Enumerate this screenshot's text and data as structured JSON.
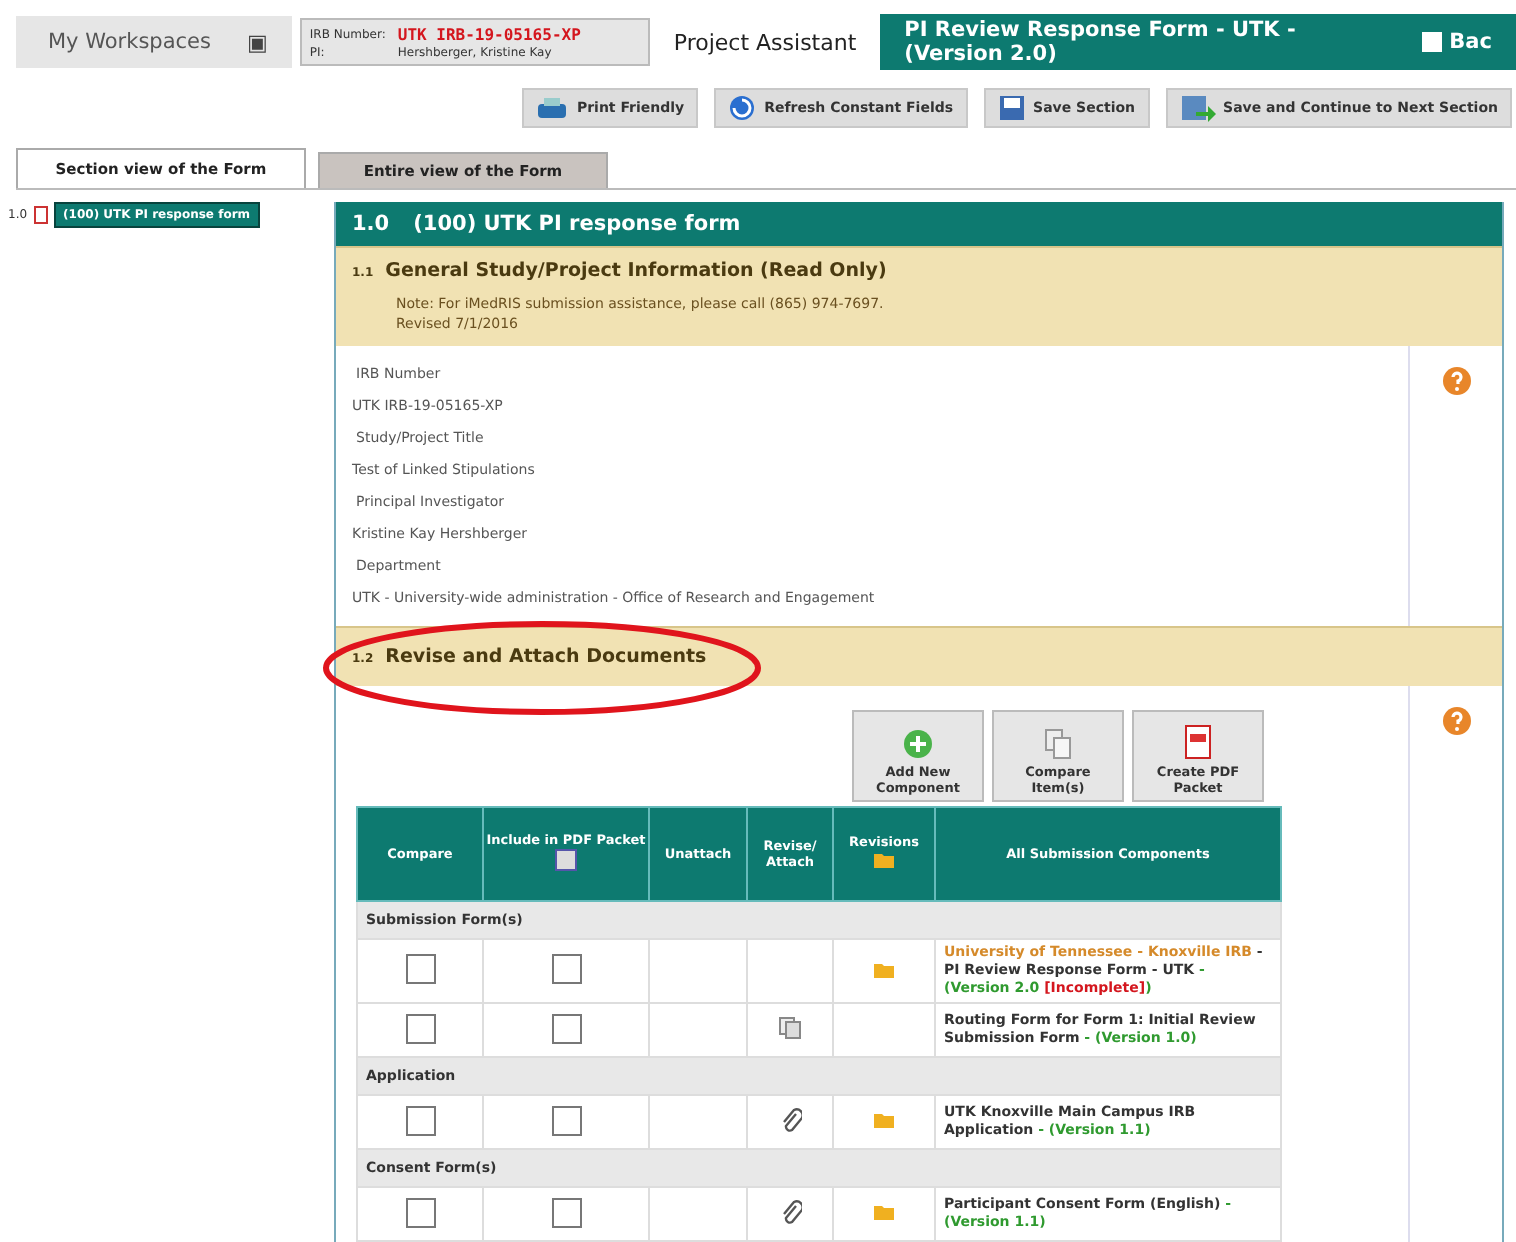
{
  "header": {
    "workspaces": "My Workspaces",
    "menu_glyph": "▣",
    "irb_label": "IRB Number:",
    "irb_value": "UTK IRB-19-05165-XP",
    "pi_label": "PI:",
    "pi_value": "Hershberger, Kristine Kay",
    "assistant": "Project Assistant",
    "form_title": "PI Review Response Form - UTK - (Version 2.0)",
    "back": "Bac"
  },
  "toolbar": [
    {
      "label": "Print Friendly"
    },
    {
      "label": "Refresh Constant Fields"
    },
    {
      "label": "Save Section"
    },
    {
      "label": "Save and Continue to Next Section"
    }
  ],
  "tabs": [
    {
      "label": "Section view of the Form",
      "selected": true
    },
    {
      "label": "Entire view of the Form",
      "selected": false
    }
  ],
  "tree": [
    {
      "number": "1.0",
      "label": "(100) UTK PI response form",
      "selected": true
    }
  ],
  "section": {
    "number": "1.0",
    "title": "(100) UTK PI response form"
  },
  "general": {
    "number": "1.1",
    "title": "General Study/Project Information (Read Only)",
    "note": "Note: For iMedRIS submission assistance, please call (865) 974-7697.",
    "revised": "Revised 7/1/2016"
  },
  "fields": [
    {
      "label": "IRB Number",
      "value": "UTK IRB-19-05165-XP"
    },
    {
      "label": "Study/Project Title",
      "value": "Test of Linked Stipulations"
    },
    {
      "label": "Principal Investigator",
      "value": "Kristine Kay Hershberger"
    },
    {
      "label": "Department",
      "value": "UTK - University-wide administration - Office of Research and Engagement"
    }
  ],
  "documents": {
    "number": "1.2",
    "title": "Revise and Attach Documents"
  },
  "actions": [
    {
      "label": "Add New Component"
    },
    {
      "label": "Compare Item(s)"
    },
    {
      "label": "Create PDF Packet"
    }
  ],
  "table": {
    "columns": [
      "Compare",
      "Include in PDF Packet",
      "Unattach",
      "Revise/ Attach",
      "Revisions",
      "All Submission Components"
    ],
    "groups": [
      {
        "name": "Submission Form(s)",
        "rows": [
          {
            "compare": false,
            "include": false,
            "kind": "form",
            "revisions": true,
            "parts": [
              {
                "kind": "source",
                "text": "University of Tennessee - Knoxville IRB"
              },
              {
                "kind": "title",
                "text": " - PI Review Response Form - UTK"
              },
              {
                "kind": "version",
                "text": " - (Version 2.0 "
              },
              {
                "kind": "status",
                "text": "[Incomplete]"
              },
              {
                "kind": "version",
                "text": ")"
              }
            ]
          },
          {
            "compare": false,
            "include": false,
            "kind": "routing",
            "revisions": false,
            "parts": [
              {
                "kind": "title",
                "text": "Routing Form for Form 1: Initial Review Submission Form"
              },
              {
                "kind": "version",
                "text": " - (Version 1.0)"
              }
            ]
          }
        ]
      },
      {
        "name": "Application",
        "rows": [
          {
            "compare": false,
            "include": false,
            "kind": "attached",
            "revisions": true,
            "parts": [
              {
                "kind": "title",
                "text": "UTK Knoxville Main Campus IRB Application"
              },
              {
                "kind": "version",
                "text": " - (Version 1.1)"
              }
            ]
          }
        ]
      },
      {
        "name": "Consent Form(s)",
        "rows": [
          {
            "compare": false,
            "include": false,
            "kind": "attached",
            "revisions": true,
            "parts": [
              {
                "kind": "title",
                "text": "Participant Consent Form (English)"
              },
              {
                "kind": "version",
                "text": " - (Version 1.1)"
              }
            ]
          }
        ]
      }
    ]
  }
}
